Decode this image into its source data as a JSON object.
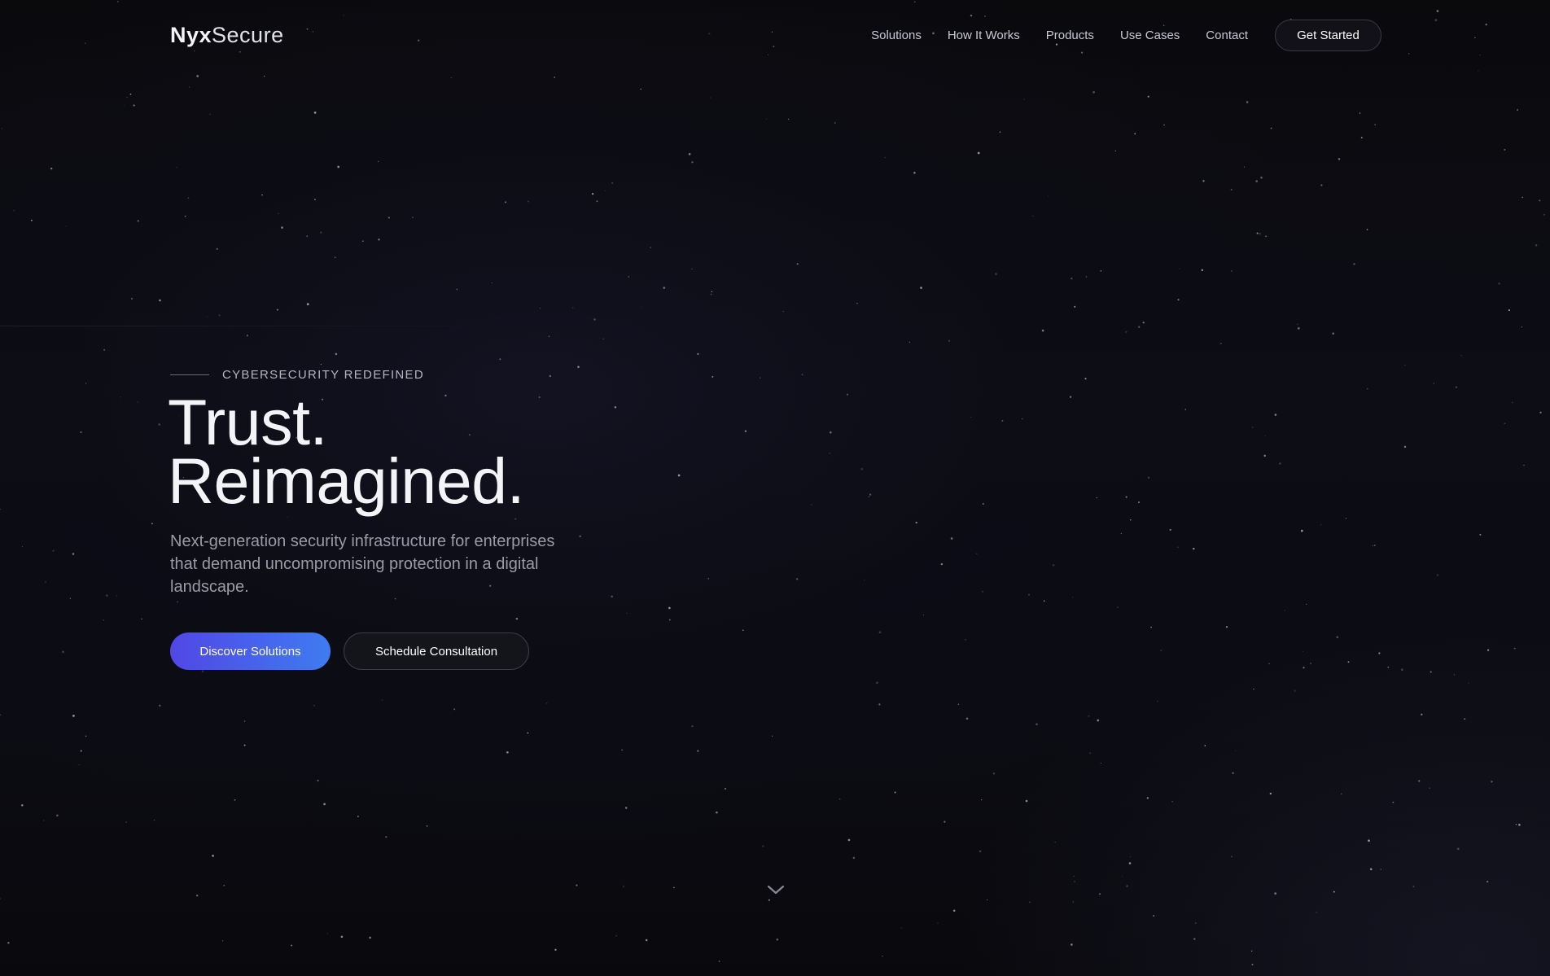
{
  "brand": {
    "logo_strong": "Nyx",
    "logo_light": "Secure"
  },
  "nav": {
    "links": [
      "Solutions",
      "How It Works",
      "Products",
      "Use Cases",
      "Contact"
    ],
    "cta_label": "Get Started"
  },
  "hero": {
    "eyebrow": "CYBERSECURITY REDEFINED",
    "headline_line1": "Trust.",
    "headline_line2": "Reimagined.",
    "subtitle": "Next-generation security infrastructure for enterprises that demand uncompromising protection in a digital landscape.",
    "primary_cta": "Discover Solutions",
    "secondary_cta": "Schedule Consultation"
  },
  "scroll_indicator": {
    "icon": "chevron-down-icon"
  },
  "colors": {
    "background": "#0b0b10",
    "accent_start": "#5147e6",
    "accent_end": "#3f7bf0",
    "text_primary": "#f4f4f8",
    "text_muted": "#9a9aa8"
  }
}
